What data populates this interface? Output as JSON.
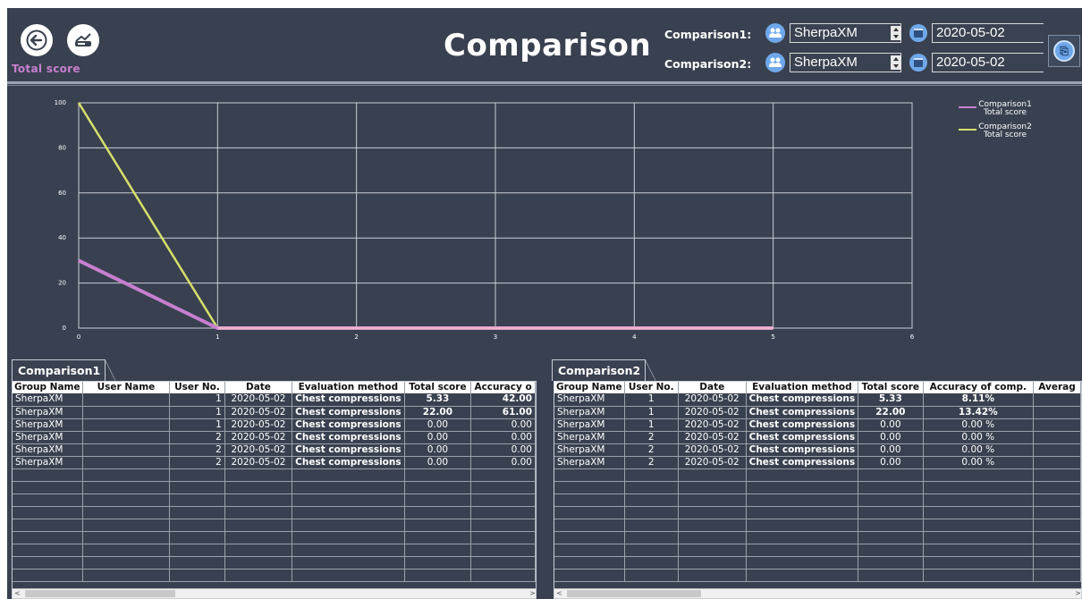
{
  "header": {
    "title": "Comparison",
    "subtitle": "Total score",
    "back_icon": "back-arrow-icon",
    "report_icon": "monitor-report-icon"
  },
  "comparison_selectors": [
    {
      "label": "Comparison1:",
      "group": "SherpaXM",
      "date": "2020-05-02"
    },
    {
      "label": "Comparison2:",
      "group": "SherpaXM",
      "date": "2020-05-02"
    }
  ],
  "side_button_icon": "export-icon",
  "colors": {
    "background": "#394150",
    "series1": "#c77fd0",
    "series2": "#d6e06a",
    "accent": "#6fa8ea"
  },
  "chart_data": {
    "type": "line",
    "x_ticks": [
      "0",
      "1",
      "2",
      "3",
      "4",
      "5",
      "6"
    ],
    "y_ticks": [
      "0",
      "20",
      "40",
      "60",
      "80",
      "100"
    ],
    "xlim": [
      0,
      6
    ],
    "ylim": [
      0,
      100
    ],
    "grid": true,
    "legend_position": "top-right",
    "series": [
      {
        "name": "Comparison1 Total score",
        "legend_lines": [
          "Comparison1",
          "Total score"
        ],
        "color": "#c77fd0",
        "x": [
          0,
          1,
          2,
          3,
          4,
          5
        ],
        "y": [
          30,
          0,
          0,
          0,
          0,
          0
        ]
      },
      {
        "name": "Comparison2 Total score",
        "legend_lines": [
          "Comparison2",
          "Total score"
        ],
        "color": "#d6e06a",
        "x": [
          0,
          1,
          2,
          3,
          4,
          5
        ],
        "y": [
          100,
          0,
          0,
          0,
          0,
          0
        ]
      }
    ]
  },
  "panel1": {
    "tab": "Comparison1",
    "columns": [
      "Group Name",
      "User Name",
      "User No.",
      "Date",
      "Evaluation method",
      "Total score",
      "Accuracy o"
    ],
    "rows": [
      [
        "SherpaXM",
        "",
        "1",
        "2020-05-02",
        "Chest compressions",
        "5.33",
        "42.00"
      ],
      [
        "SherpaXM",
        "",
        "1",
        "2020-05-02",
        "Chest compressions",
        "22.00",
        "61.00"
      ],
      [
        "SherpaXM",
        "",
        "1",
        "2020-05-02",
        "Chest compressions",
        "0.00",
        "0.00"
      ],
      [
        "SherpaXM",
        "",
        "2",
        "2020-05-02",
        "Chest compressions",
        "0.00",
        "0.00"
      ],
      [
        "SherpaXM",
        "",
        "2",
        "2020-05-02",
        "Chest compressions",
        "0.00",
        "0.00"
      ],
      [
        "SherpaXM",
        "",
        "2",
        "2020-05-02",
        "Chest compressions",
        "0.00",
        "0.00"
      ]
    ]
  },
  "panel2": {
    "tab": "Comparison2",
    "columns": [
      "Group Name",
      "User No.",
      "Date",
      "Evaluation method",
      "Total score",
      "Accuracy of comp.",
      "Averag"
    ],
    "rows": [
      [
        "SherpaXM",
        "1",
        "2020-05-02",
        "Chest compressions",
        "5.33",
        "8.11%",
        ""
      ],
      [
        "SherpaXM",
        "1",
        "2020-05-02",
        "Chest compressions",
        "22.00",
        "13.42%",
        ""
      ],
      [
        "SherpaXM",
        "1",
        "2020-05-02",
        "Chest compressions",
        "0.00",
        "0.00 %",
        ""
      ],
      [
        "SherpaXM",
        "2",
        "2020-05-02",
        "Chest compressions",
        "0.00",
        "0.00 %",
        ""
      ],
      [
        "SherpaXM",
        "2",
        "2020-05-02",
        "Chest compressions",
        "0.00",
        "0.00 %",
        ""
      ],
      [
        "SherpaXM",
        "2",
        "2020-05-02",
        "Chest compressions",
        "0.00",
        "0.00 %",
        ""
      ]
    ]
  }
}
